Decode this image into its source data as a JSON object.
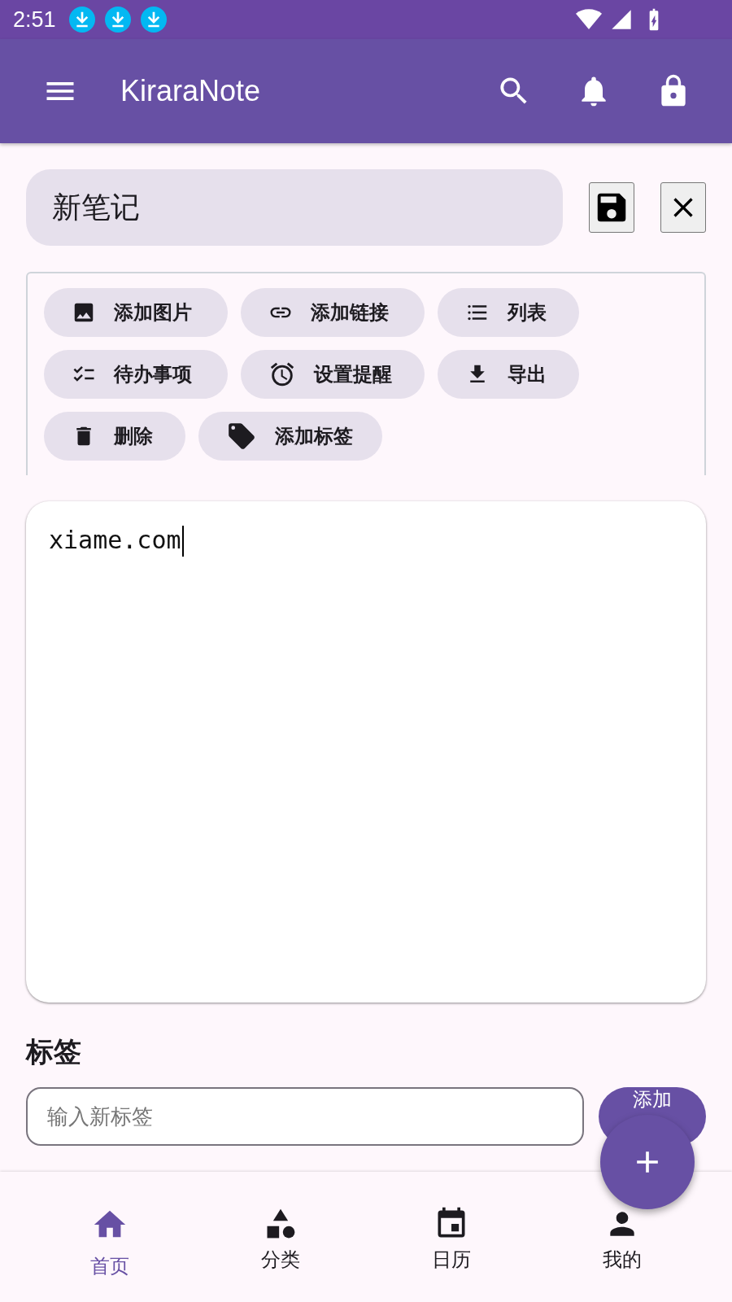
{
  "status_bar": {
    "time": "2:51"
  },
  "app_bar": {
    "title": "KiraraNote"
  },
  "note_title": {
    "value": "新笔记"
  },
  "toolbar": {
    "chips": [
      {
        "label": "添加图片"
      },
      {
        "label": "添加链接"
      },
      {
        "label": "列表"
      },
      {
        "label": "待办事项"
      },
      {
        "label": "设置提醒"
      },
      {
        "label": "导出"
      },
      {
        "label": "删除"
      },
      {
        "label": "添加标签"
      }
    ]
  },
  "editor": {
    "value": "xiame.com",
    "focused": true
  },
  "tags": {
    "heading": "标签",
    "input": {
      "placeholder": "输入新标签"
    },
    "add_button": "添加"
  },
  "bottom_nav": [
    {
      "label": "首页",
      "selected": true
    },
    {
      "label": "分类",
      "selected": false
    },
    {
      "label": "日历",
      "selected": false
    },
    {
      "label": "我的",
      "selected": false
    }
  ]
}
